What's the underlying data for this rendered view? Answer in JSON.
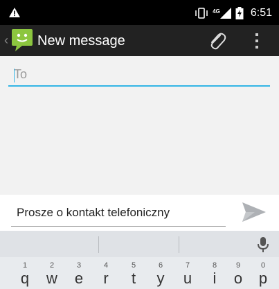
{
  "status_bar": {
    "network_label": "4G",
    "time": "6:51"
  },
  "action_bar": {
    "title": "New message"
  },
  "compose": {
    "to_placeholder": "To"
  },
  "message": {
    "text": "Prosze o kontakt telefoniczny"
  },
  "keyboard": {
    "keys": [
      {
        "num": "1",
        "ch": "q"
      },
      {
        "num": "2",
        "ch": "w"
      },
      {
        "num": "3",
        "ch": "e"
      },
      {
        "num": "4",
        "ch": "r"
      },
      {
        "num": "5",
        "ch": "t"
      },
      {
        "num": "6",
        "ch": "y"
      },
      {
        "num": "7",
        "ch": "u"
      },
      {
        "num": "8",
        "ch": "i"
      },
      {
        "num": "9",
        "ch": "o"
      },
      {
        "num": "0",
        "ch": "p"
      }
    ]
  },
  "icons": {
    "warning": "warning-icon",
    "vibrate": "vibrate-icon",
    "signal": "signal-icon",
    "battery": "battery-charging-icon",
    "app": "messaging-app-icon",
    "attach": "paperclip-icon",
    "overflow": "overflow-menu-icon",
    "send": "send-icon",
    "mic": "microphone-icon"
  },
  "colors": {
    "accent": "#33b5e5",
    "app_icon": "#8cc63f",
    "action_bar": "#222222"
  }
}
